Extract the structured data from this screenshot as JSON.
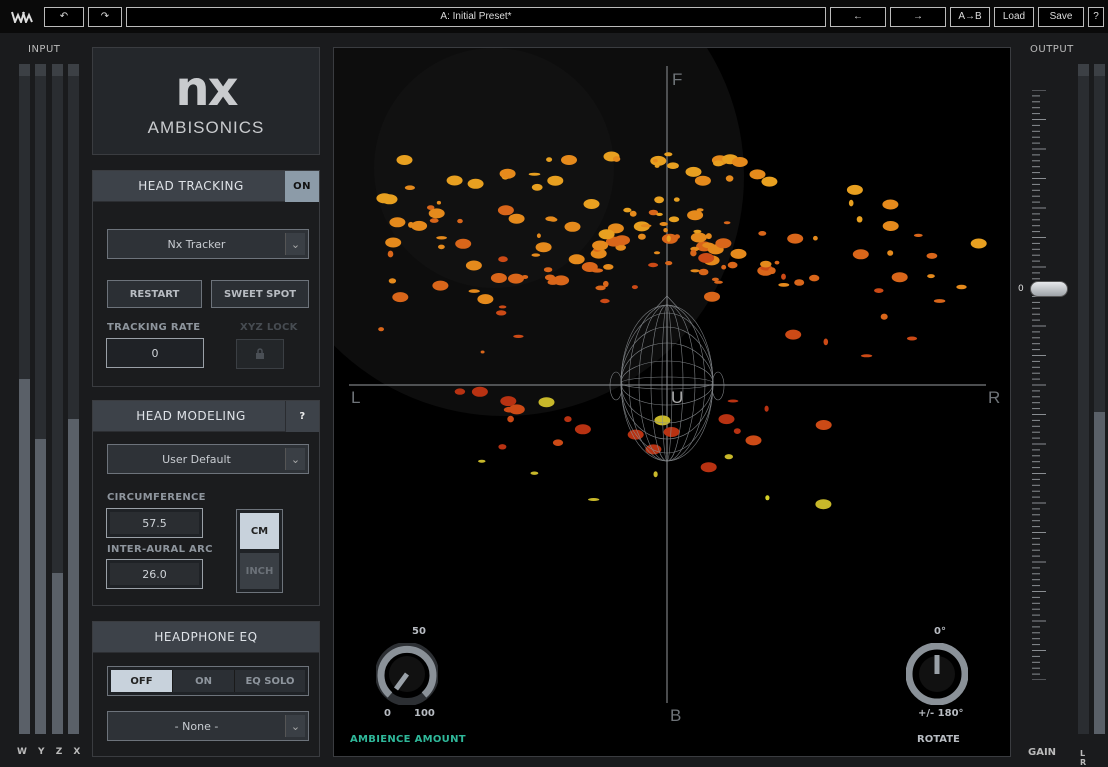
{
  "toolbar": {
    "logo": "W",
    "preset": "A: Initial Preset*",
    "ab_label": "A→B",
    "load_label": "Load",
    "save_label": "Save",
    "help_label": "?"
  },
  "input": {
    "label": "INPUT",
    "channels": "W Y Z X",
    "levels": [
      0.53,
      0.44,
      0.24,
      0.47
    ]
  },
  "brand": {
    "nx": "nx",
    "product": "AMBISONICS"
  },
  "head_tracking": {
    "title": "HEAD TRACKING",
    "toggle": "ON",
    "tracker": "Nx Tracker",
    "restart": "RESTART",
    "sweet_spot": "SWEET SPOT",
    "rate_label": "TRACKING RATE",
    "rate_value": "0",
    "xyz_label": "XYZ LOCK"
  },
  "head_modeling": {
    "title": "HEAD MODELING",
    "help": "?",
    "model": "User Default",
    "circ_label": "CIRCUMFERENCE",
    "circ_value": "57.5",
    "arc_label": "INTER-AURAL  ARC",
    "arc_value": "26.0",
    "cm": "CM",
    "inch": "INCH"
  },
  "headphone_eq": {
    "title": "HEADPHONE EQ",
    "off": "OFF",
    "on": "ON",
    "solo": "EQ SOLO",
    "model": "- None -"
  },
  "display": {
    "front": "F",
    "back": "B",
    "left": "L",
    "right": "R",
    "up": "U"
  },
  "ambience": {
    "label": "AMBIENCE AMOUNT",
    "top": "50",
    "min": "0",
    "max": "100"
  },
  "rotate": {
    "label": "ROTATE",
    "top": "0°",
    "bottom": "+/- 180°"
  },
  "output": {
    "label": "OUTPUT",
    "gain_label": "GAIN",
    "gain_value": "0",
    "channels": "L R",
    "levels": [
      0,
      0.48
    ]
  },
  "colors": {
    "accent_green": "#2fb89a"
  }
}
